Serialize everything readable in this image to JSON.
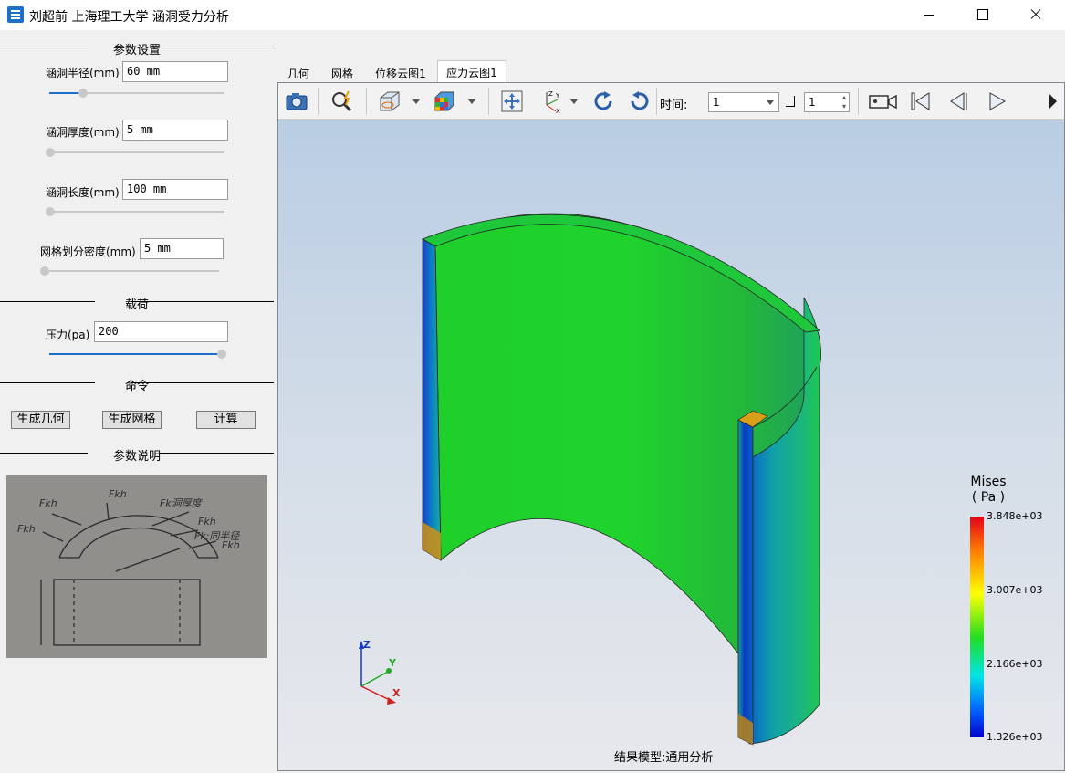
{
  "window": {
    "title": "刘超前 上海理工大学 涵洞受力分析"
  },
  "sections": {
    "params": "参数设置",
    "load": "载荷",
    "commands": "命令",
    "explain": "参数说明"
  },
  "fields": {
    "radius": {
      "label": "涵洞半径(mm)",
      "value": "60 mm",
      "slider": 0.2
    },
    "thickness": {
      "label": "涵洞厚度(mm)",
      "value": "5 mm",
      "slider": 0.0
    },
    "length": {
      "label": "涵洞长度(mm)",
      "value": "100 mm",
      "slider": 0.0
    },
    "mesh": {
      "label": "网格划分密度(mm)",
      "value": "5 mm",
      "slider": 0.0
    },
    "pressure": {
      "label": "压力(pa)",
      "value": "200",
      "slider": 1.0
    }
  },
  "buttons": {
    "gen_geometry": "生成几何",
    "gen_mesh": "生成网格",
    "compute": "计算"
  },
  "tabs": [
    "几何",
    "网格",
    "位移云图1",
    "应力云图1"
  ],
  "active_tab": 3,
  "toolbar": {
    "time_label": "时间:",
    "time_value": "1",
    "step_value": "1",
    "icons": [
      "camera-icon",
      "zoom-icon",
      "view-cube-icon",
      "color-cube-icon",
      "fit-icon",
      "axes-icon",
      "rotate-cw-icon",
      "rotate-ccw-icon",
      "record-icon",
      "first-frame-icon",
      "prev-frame-icon",
      "play-icon"
    ]
  },
  "viewer": {
    "model_label": "结果模型:通用分析",
    "legend": {
      "title": "Mises",
      "unit": "( Pa )",
      "ticks": [
        "3.848e+03",
        "3.007e+03",
        "2.166e+03",
        "1.326e+03"
      ]
    },
    "axes": [
      "Z",
      "Y",
      "X"
    ]
  },
  "colors": {
    "accent": "#1e6fc9",
    "stress_high": "#e5001a",
    "stress_mid": "#22dd22",
    "stress_low": "#0000cc"
  }
}
